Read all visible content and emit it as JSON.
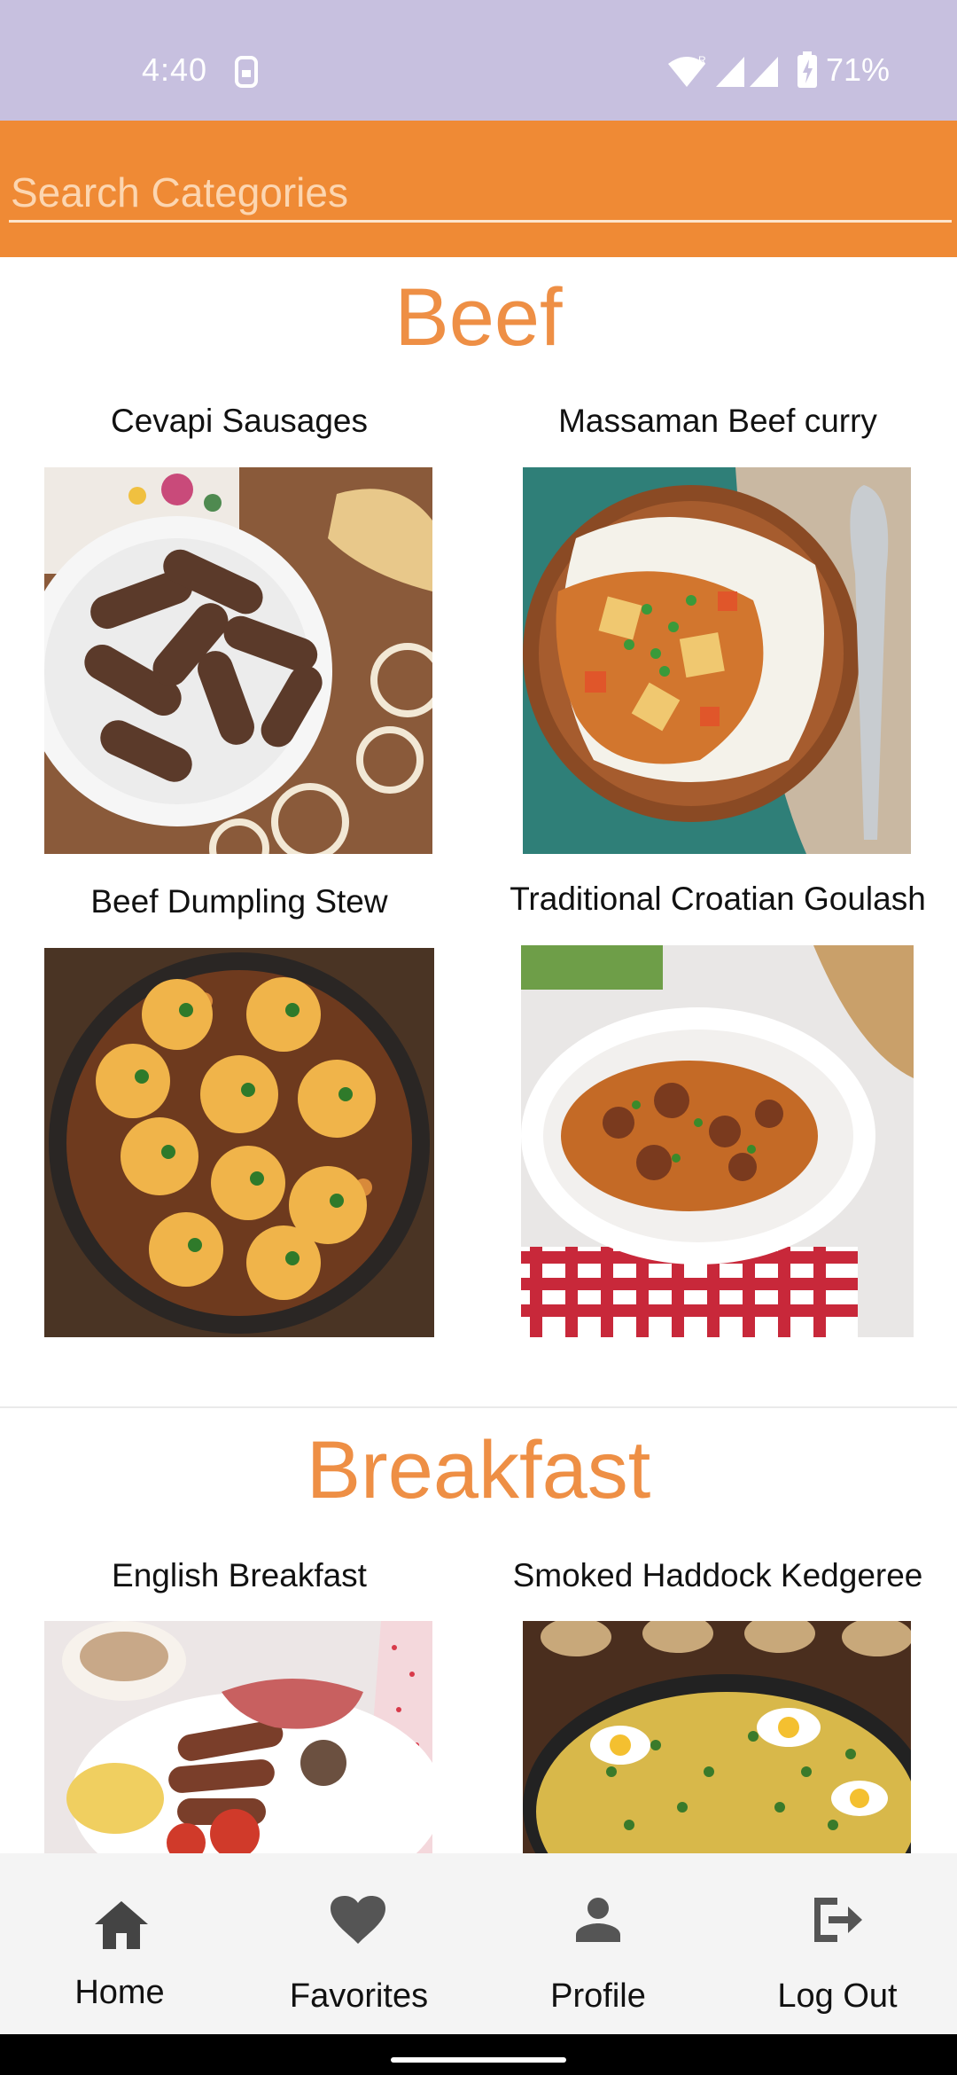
{
  "status_bar": {
    "time": "4:40",
    "battery_text": "71%",
    "icons": [
      "sim-card-icon",
      "wifi-icon",
      "signal-icon",
      "battery-icon"
    ]
  },
  "search": {
    "placeholder": "Search Categories",
    "value": ""
  },
  "categories": [
    {
      "title": "Beef",
      "meals": [
        {
          "name": "Cevapi Sausages"
        },
        {
          "name": "Massaman Beef curry"
        },
        {
          "name": "Beef Dumpling Stew"
        },
        {
          "name": "Traditional Croatian Goulash"
        }
      ]
    },
    {
      "title": "Breakfast",
      "meals": [
        {
          "name": "English Breakfast"
        },
        {
          "name": "Smoked Haddock Kedgeree"
        }
      ]
    }
  ],
  "bottom_nav": {
    "items": [
      {
        "label": "Home",
        "icon": "home-icon"
      },
      {
        "label": "Favorites",
        "icon": "heart-icon"
      },
      {
        "label": "Profile",
        "icon": "person-icon"
      },
      {
        "label": "Log Out",
        "icon": "logout-icon"
      }
    ]
  },
  "colors": {
    "status_bar": "#c7c0df",
    "accent": "#ef8a35",
    "category_title": "#ee8f45",
    "nav_background": "#f4f4f4"
  }
}
